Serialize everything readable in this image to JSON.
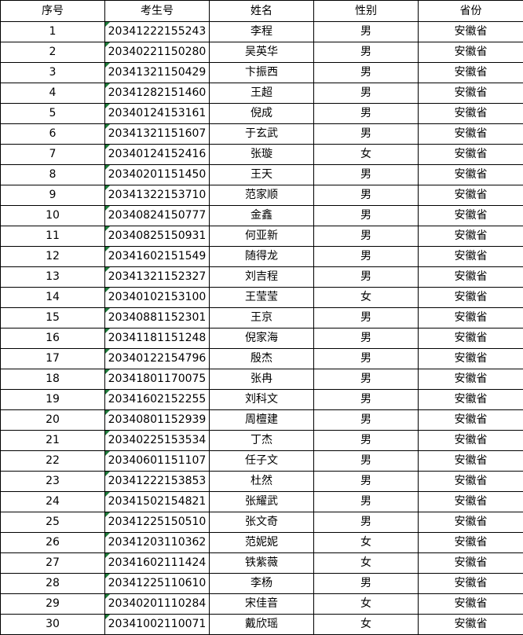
{
  "headers": [
    "序号",
    "考生号",
    "姓名",
    "性别",
    "省份"
  ],
  "rows": [
    [
      "1",
      "20341222155243",
      "李程",
      "男",
      "安徽省"
    ],
    [
      "2",
      "20340221150280",
      "吴英华",
      "男",
      "安徽省"
    ],
    [
      "3",
      "20341321150429",
      "卞振西",
      "男",
      "安徽省"
    ],
    [
      "4",
      "20341282151460",
      "王超",
      "男",
      "安徽省"
    ],
    [
      "5",
      "20340124153161",
      "倪成",
      "男",
      "安徽省"
    ],
    [
      "6",
      "20341321151607",
      "于玄武",
      "男",
      "安徽省"
    ],
    [
      "7",
      "20340124152416",
      "张璇",
      "女",
      "安徽省"
    ],
    [
      "8",
      "20340201151450",
      "王天",
      "男",
      "安徽省"
    ],
    [
      "9",
      "20341322153710",
      "范家顺",
      "男",
      "安徽省"
    ],
    [
      "10",
      "20340824150777",
      "金鑫",
      "男",
      "安徽省"
    ],
    [
      "11",
      "20340825150931",
      "何亚新",
      "男",
      "安徽省"
    ],
    [
      "12",
      "20341602151549",
      "随得龙",
      "男",
      "安徽省"
    ],
    [
      "13",
      "20341321152327",
      "刘吉程",
      "男",
      "安徽省"
    ],
    [
      "14",
      "20340102153100",
      "王莹莹",
      "女",
      "安徽省"
    ],
    [
      "15",
      "20340881152301",
      "王京",
      "男",
      "安徽省"
    ],
    [
      "16",
      "20341181151248",
      "倪家海",
      "男",
      "安徽省"
    ],
    [
      "17",
      "20340122154796",
      "殷杰",
      "男",
      "安徽省"
    ],
    [
      "18",
      "20341801170075",
      "张冉",
      "男",
      "安徽省"
    ],
    [
      "19",
      "20341602152255",
      "刘科文",
      "男",
      "安徽省"
    ],
    [
      "20",
      "20340801152939",
      "周檀建",
      "男",
      "安徽省"
    ],
    [
      "21",
      "20340225153534",
      "丁杰",
      "男",
      "安徽省"
    ],
    [
      "22",
      "20340601151107",
      "任子文",
      "男",
      "安徽省"
    ],
    [
      "23",
      "20341222153853",
      "杜然",
      "男",
      "安徽省"
    ],
    [
      "24",
      "20341502154821",
      "张耀武",
      "男",
      "安徽省"
    ],
    [
      "25",
      "20341225150510",
      "张文奇",
      "男",
      "安徽省"
    ],
    [
      "26",
      "20341203110362",
      "范妮妮",
      "女",
      "安徽省"
    ],
    [
      "27",
      "20341602111424",
      "铁紫薇",
      "女",
      "安徽省"
    ],
    [
      "28",
      "20341225110610",
      "李杨",
      "男",
      "安徽省"
    ],
    [
      "29",
      "20340201110284",
      "宋佳音",
      "女",
      "安徽省"
    ],
    [
      "30",
      "20341002110071",
      "戴欣瑶",
      "女",
      "安徽省"
    ]
  ],
  "colors": {
    "grid_border": "#000000",
    "text_indicator": "#1f7a3a",
    "background": "#ffffff"
  }
}
